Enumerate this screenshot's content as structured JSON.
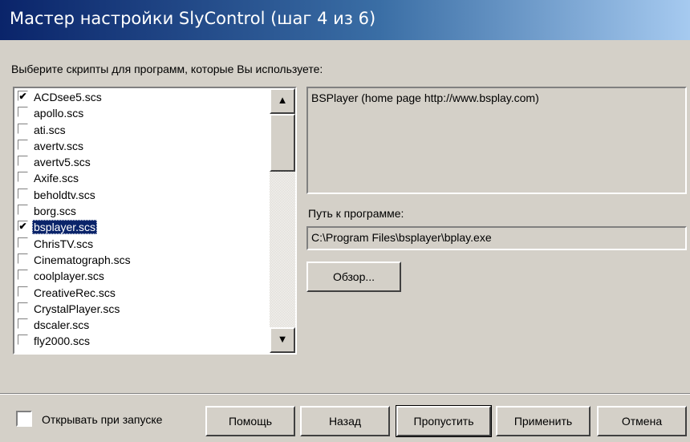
{
  "window": {
    "title": "Мастер настройки SlyControl (шаг 4 из 6)"
  },
  "instruction": "Выберите скрипты для программ, которые Вы используете:",
  "scripts": [
    {
      "label": "ACDsee5.scs",
      "checked": true
    },
    {
      "label": "apollo.scs",
      "checked": false
    },
    {
      "label": "ati.scs",
      "checked": false
    },
    {
      "label": "avertv.scs",
      "checked": false
    },
    {
      "label": "avertv5.scs",
      "checked": false
    },
    {
      "label": "Axife.scs",
      "checked": false
    },
    {
      "label": "beholdtv.scs",
      "checked": false
    },
    {
      "label": "borg.scs",
      "checked": false
    },
    {
      "label": "bsplayer.scs",
      "checked": true,
      "selected": true
    },
    {
      "label": "ChrisTV.scs",
      "checked": false
    },
    {
      "label": "Cinematograph.scs",
      "checked": false
    },
    {
      "label": "coolplayer.scs",
      "checked": false
    },
    {
      "label": "CreativeRec.scs",
      "checked": false
    },
    {
      "label": "CrystalPlayer.scs",
      "checked": false
    },
    {
      "label": "dscaler.scs",
      "checked": false
    },
    {
      "label": "fly2000.scs",
      "checked": false
    }
  ],
  "scrollbar": {
    "up_icon": "up-arrow",
    "down_icon": "down-arrow"
  },
  "description": "BSPlayer (home page http://www.bsplay.com)",
  "path": {
    "label": "Путь к программе:",
    "value": "C:\\Program Files\\bsplayer\\bplay.exe"
  },
  "browse_label": "Обзор...",
  "footer": {
    "startup_label": "Открывать при запуске",
    "startup_checked": false,
    "help_label": "Помощь",
    "back_label": "Назад",
    "skip_label": "Пропустить",
    "apply_label": "Применить",
    "cancel_label": "Отмена"
  },
  "colors": {
    "titlebar_start": "#0a246a",
    "titlebar_end": "#a6caf0",
    "selection": "#0a246a",
    "face": "#d4d0c8"
  }
}
